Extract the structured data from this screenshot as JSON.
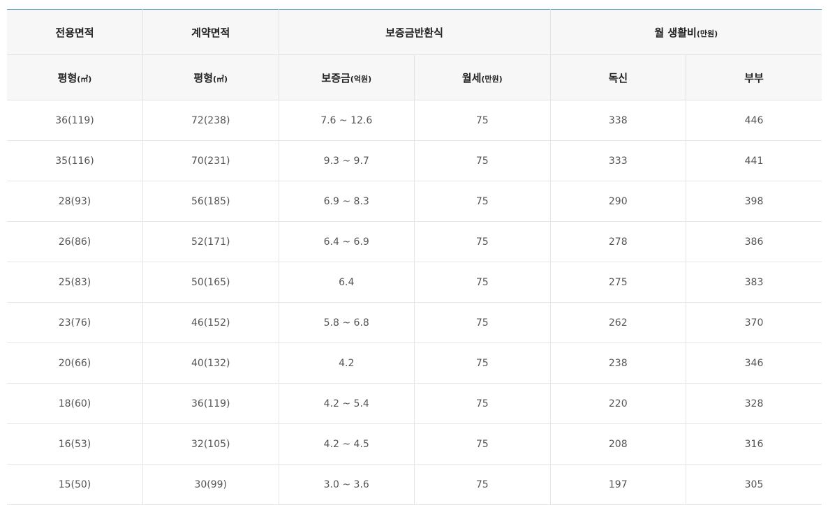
{
  "header": {
    "row1": {
      "exclusive_area": "전용면적",
      "contract_area": "계약면적",
      "deposit_return": "보증금반환식",
      "living_cost": "월 생활비",
      "living_cost_unit": "(만원)"
    },
    "row2": {
      "pyeong1": "평형",
      "pyeong1_unit": "(㎡)",
      "pyeong2": "평형",
      "pyeong2_unit": "(㎡)",
      "deposit": "보증금",
      "deposit_unit": "(억원)",
      "monthly_rent": "월세",
      "monthly_rent_unit": "(만원)",
      "single": "독신",
      "couple": "부부"
    }
  },
  "rows": [
    [
      "36(119)",
      "72(238)",
      "7.6 ~ 12.6",
      "75",
      "338",
      "446"
    ],
    [
      "35(116)",
      "70(231)",
      "9.3 ~ 9.7",
      "75",
      "333",
      "441"
    ],
    [
      "28(93)",
      "56(185)",
      "6.9 ~ 8.3",
      "75",
      "290",
      "398"
    ],
    [
      "26(86)",
      "52(171)",
      "6.4 ~ 6.9",
      "75",
      "278",
      "386"
    ],
    [
      "25(83)",
      "50(165)",
      "6.4",
      "75",
      "275",
      "383"
    ],
    [
      "23(76)",
      "46(152)",
      "5.8 ~ 6.8",
      "75",
      "262",
      "370"
    ],
    [
      "20(66)",
      "40(132)",
      "4.2",
      "75",
      "238",
      "346"
    ],
    [
      "18(60)",
      "36(119)",
      "4.2 ~ 5.4",
      "75",
      "220",
      "328"
    ],
    [
      "16(53)",
      "32(105)",
      "4.2 ~ 4.5",
      "75",
      "208",
      "316"
    ],
    [
      "15(50)",
      "30(99)",
      "3.0 ~ 3.6",
      "75",
      "197",
      "305"
    ]
  ]
}
